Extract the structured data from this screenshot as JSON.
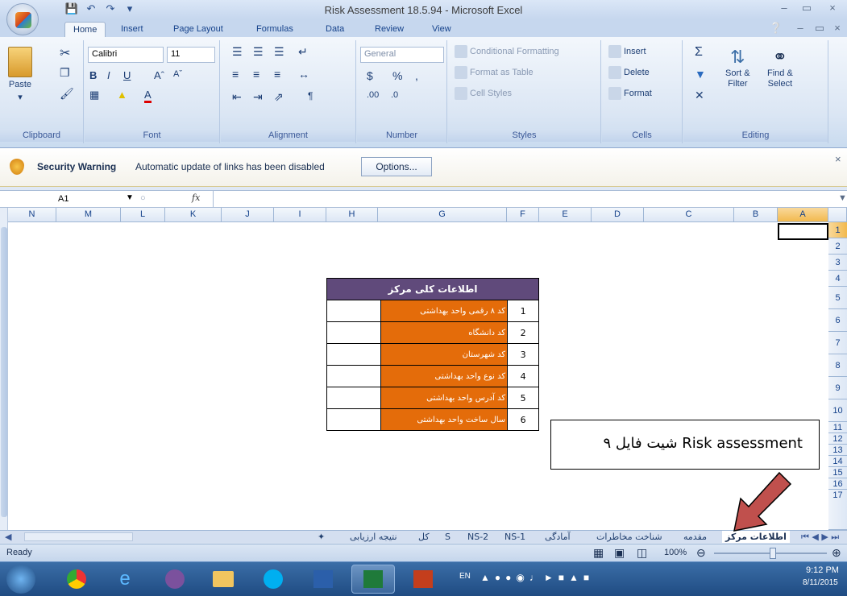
{
  "window": {
    "title": "Risk Assessment 18.5.94 - Microsoft Excel"
  },
  "tabs": [
    "Home",
    "Insert",
    "Page Layout",
    "Formulas",
    "Data",
    "Review",
    "View"
  ],
  "ribbon": {
    "clipboard": {
      "label": "Clipboard",
      "paste": "Paste"
    },
    "font": {
      "label": "Font",
      "name": "Calibri",
      "size": "11"
    },
    "alignment": {
      "label": "Alignment"
    },
    "number": {
      "label": "Number",
      "format": "General"
    },
    "styles": {
      "label": "Styles",
      "conditional": "Conditional Formatting",
      "table": "Format as Table",
      "cell": "Cell Styles"
    },
    "cells": {
      "label": "Cells",
      "insert": "Insert",
      "delete": "Delete",
      "format": "Format"
    },
    "editing": {
      "label": "Editing",
      "sort": "Sort &",
      "sort2": "Filter",
      "find": "Find &",
      "find2": "Select"
    }
  },
  "security": {
    "title": "Security Warning",
    "message": "Automatic update of links has been disabled",
    "button": "Options..."
  },
  "formula_bar": {
    "name_box": "A1",
    "fx": "fx",
    "formula": ""
  },
  "columns": [
    "N",
    "M",
    "L",
    "K",
    "J",
    "I",
    "H",
    "G",
    "F",
    "E",
    "D",
    "C",
    "B",
    "A"
  ],
  "rows": [
    "1",
    "2",
    "3",
    "4",
    "5",
    "6",
    "7",
    "8",
    "9",
    "10",
    "11",
    "12",
    "13",
    "14",
    "15",
    "16",
    "17"
  ],
  "table": {
    "header": "اطلاعات کلی مرکز",
    "rows": [
      {
        "num": "1",
        "label": "کد ۸ رقمی واحد بهداشتی",
        "value": ""
      },
      {
        "num": "2",
        "label": "کد دانشگاه",
        "value": ""
      },
      {
        "num": "3",
        "label": "کد شهرستان",
        "value": ""
      },
      {
        "num": "4",
        "label": "کد نوع واحد بهداشتی",
        "value": ""
      },
      {
        "num": "5",
        "label": "کد آدرس واحد بهداشتی",
        "value": ""
      },
      {
        "num": "6",
        "label": "سال ساخت واحد بهداشتی",
        "value": ""
      }
    ]
  },
  "callout": {
    "text": "۹ شیت فایل Risk assessment"
  },
  "sheet_tabs": [
    "اطلاعات مرکز",
    "مقدمه",
    "شناخت مخاطرات",
    "آمادگی",
    "NS-1",
    "NS-2",
    "S",
    "کل",
    "نتیجه ارزیابی"
  ],
  "status": {
    "ready": "Ready",
    "zoom": "100%"
  },
  "taskbar": {
    "lang": "EN",
    "time": "9:12 PM",
    "date": "8/11/2015"
  }
}
